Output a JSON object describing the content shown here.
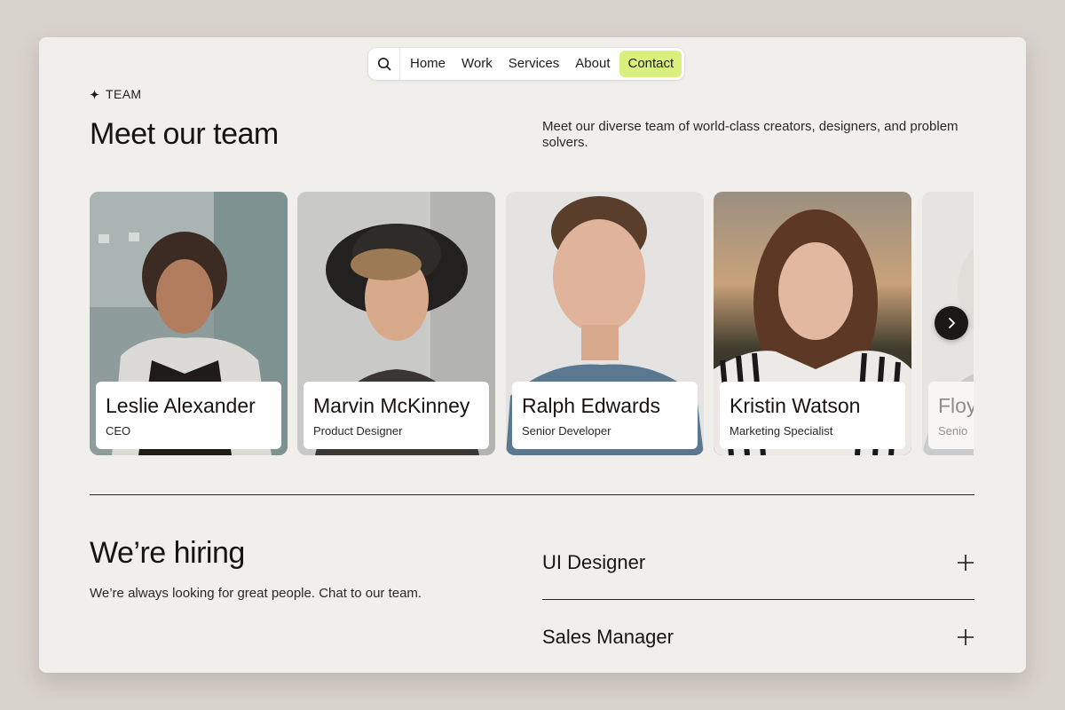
{
  "nav": {
    "items": [
      {
        "label": "Home"
      },
      {
        "label": "Work"
      },
      {
        "label": "Services"
      },
      {
        "label": "About"
      },
      {
        "label": "Contact"
      }
    ],
    "active_color": "#d9ef7e"
  },
  "team": {
    "eyebrow": "TEAM",
    "title": "Meet our team",
    "intro": "Meet our diverse team of world-class creators, designers, and problem solvers.",
    "members": [
      {
        "name": "Leslie Alexander",
        "role": "CEO"
      },
      {
        "name": "Marvin McKinney",
        "role": "Product Designer"
      },
      {
        "name": "Ralph Edwards",
        "role": "Senior Developer"
      },
      {
        "name": "Kristin Watson",
        "role": "Marketing Specialist"
      },
      {
        "name": "Floy",
        "role": "Senio"
      }
    ]
  },
  "hiring": {
    "title": "We’re hiring",
    "text": "We’re always looking for great people. Chat to our team.",
    "jobs": [
      {
        "title": "UI Designer"
      },
      {
        "title": "Sales Manager"
      }
    ]
  }
}
